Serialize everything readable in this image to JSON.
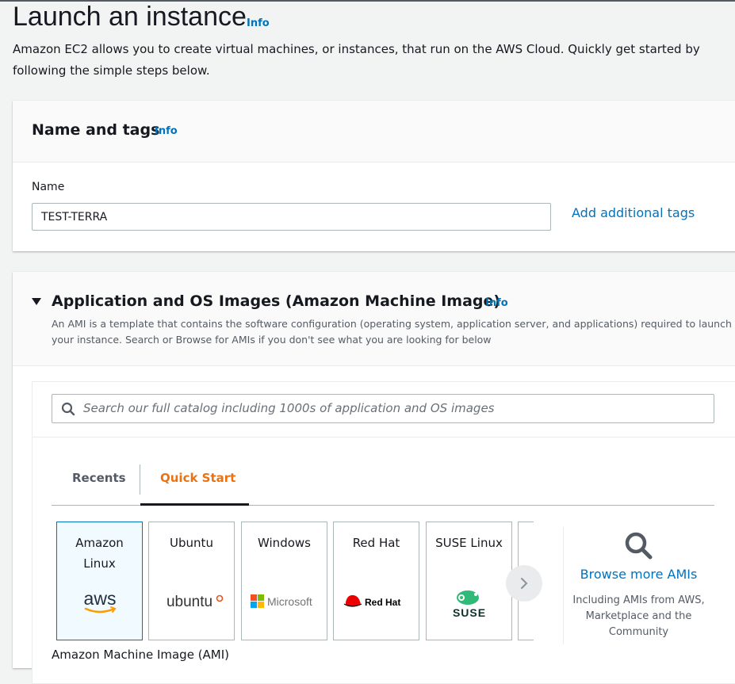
{
  "page": {
    "title": "Launch an instance",
    "info_label": "Info",
    "description": "Amazon EC2 allows you to create virtual machines, or instances, that run on the AWS Cloud. Quickly get started by following the simple steps below."
  },
  "name_tags": {
    "title": "Name and tags",
    "info_label": "Info",
    "name_label": "Name",
    "name_value": "TEST-TERRA",
    "add_tags_label": "Add additional tags"
  },
  "ami_section": {
    "title": "Application and OS Images (Amazon Machine Image)",
    "info_label": "Info",
    "description": "An AMI is a template that contains the software configuration (operating system, application server, and applications) required to launch your instance. Search or Browse for AMIs if you don't see what you are looking for below",
    "search_placeholder": "Search our full catalog including 1000s of application and OS images",
    "tabs": [
      {
        "label": "Recents",
        "active": false
      },
      {
        "label": "Quick Start",
        "active": true
      }
    ],
    "amis": [
      {
        "label": "Amazon Linux",
        "logo": "aws-logo",
        "selected": true
      },
      {
        "label": "Ubuntu",
        "logo": "ubuntu-logo",
        "selected": false
      },
      {
        "label": "Windows",
        "logo": "microsoft-logo",
        "selected": false
      },
      {
        "label": "Red Hat",
        "logo": "redhat-logo",
        "selected": false
      },
      {
        "label": "SUSE Linux",
        "logo": "suse-logo",
        "selected": false
      }
    ],
    "logo_text": {
      "aws": "aws",
      "ubuntu": "ubuntu",
      "microsoft": "Microsoft",
      "redhat": "Red Hat",
      "suse": "SUSE"
    },
    "browse_label": "Browse more AMIs",
    "browse_desc": "Including AMIs from AWS, Marketplace and the Community",
    "footer_label": "Amazon Machine Image (AMI)"
  },
  "colors": {
    "link": "#0073bb",
    "active_tab": "#ec7211",
    "selected_border": "#0073bb"
  }
}
